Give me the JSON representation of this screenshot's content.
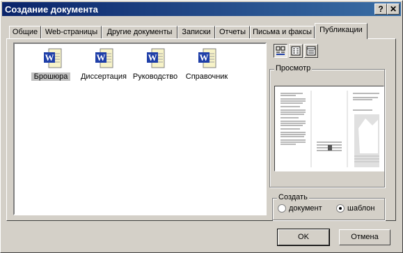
{
  "window": {
    "title": "Создание документа",
    "help_label": "?",
    "close_label": "✕"
  },
  "tabs": [
    "Общие",
    "Web-страницы",
    "Другие документы",
    "Записки",
    "Отчеты",
    "Письма и факсы",
    "Публикации"
  ],
  "active_tab_index": 6,
  "documents": [
    {
      "label": "Брошюра",
      "icon": "word-document-icon",
      "selected": true
    },
    {
      "label": "Диссертация",
      "icon": "word-document-icon",
      "selected": false
    },
    {
      "label": "Руководство",
      "icon": "word-document-icon",
      "selected": false
    },
    {
      "label": "Справочник",
      "icon": "word-document-icon",
      "selected": false
    }
  ],
  "view_buttons": [
    "large-icons-view-icon",
    "list-view-icon",
    "details-view-icon"
  ],
  "preview": {
    "label": "Просмотр"
  },
  "create": {
    "label": "Создать",
    "options": [
      "документ",
      "шаблон"
    ],
    "selected": "шаблон"
  },
  "buttons": {
    "ok": "OK",
    "cancel": "Отмена"
  },
  "colors": {
    "titlebar_start": "#0a246a",
    "titlebar_end": "#3a6ea5",
    "face": "#d4d0c8",
    "word_blue": "#1f3fa8"
  }
}
